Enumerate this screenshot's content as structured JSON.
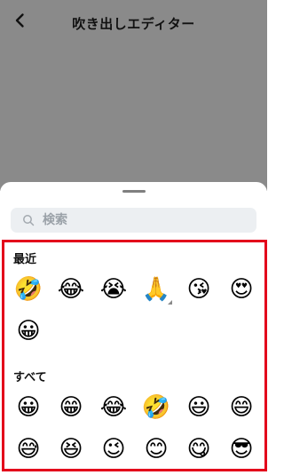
{
  "header": {
    "title": "吹き出しエディター"
  },
  "search": {
    "placeholder": "検索"
  },
  "sections": {
    "recent": {
      "label": "最近",
      "rows": [
        [
          "🤣",
          "😂",
          "😭",
          "🙏",
          "😘",
          "😍"
        ],
        [
          "😀"
        ]
      ]
    },
    "all": {
      "label": "すべて",
      "rows": [
        [
          "😀",
          "😁",
          "😂",
          "🤣",
          "😃",
          "😄"
        ],
        [
          "😅",
          "😆",
          "😉",
          "😊",
          "😋",
          "😎"
        ]
      ]
    }
  },
  "colors": {
    "highlight_border": "#e3001b",
    "dim_background": "#8a8a8a",
    "search_background": "#eceff2"
  },
  "icons": {
    "back": "chevron-left-icon",
    "search": "search-icon"
  }
}
